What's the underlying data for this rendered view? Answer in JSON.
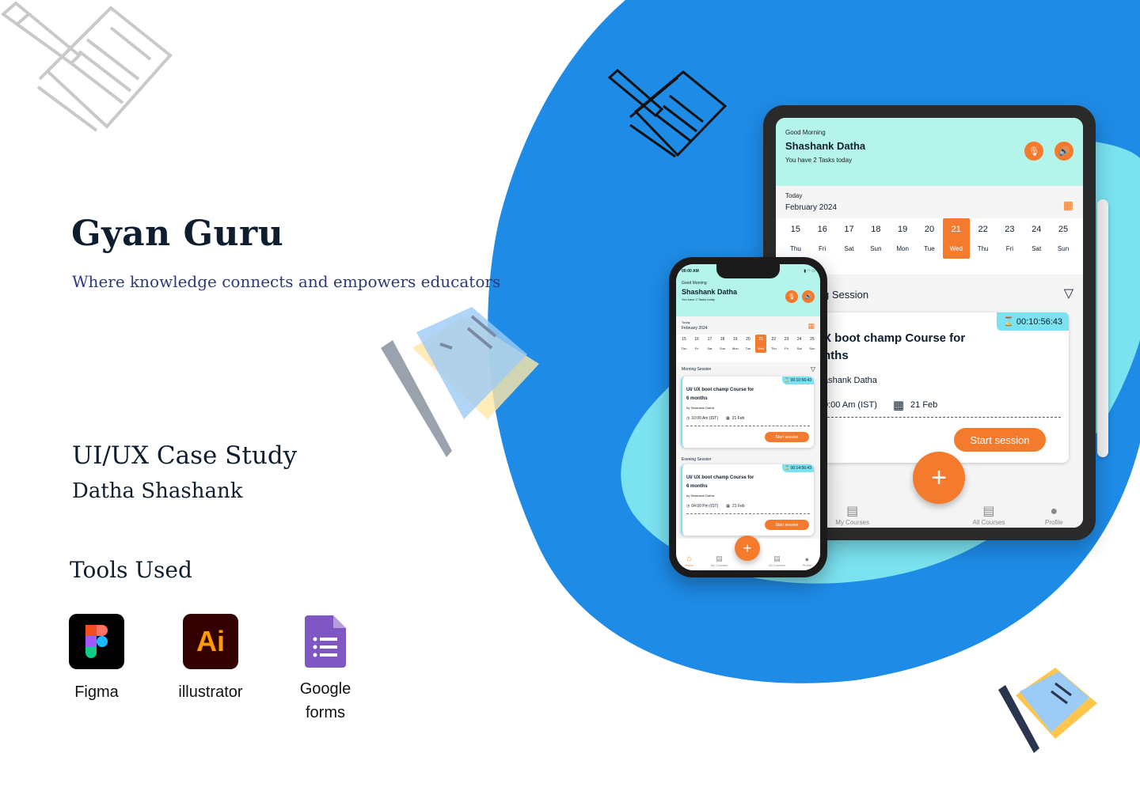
{
  "colors": {
    "blue": "#1e8be6",
    "light_blue": "#7be2f0",
    "orange": "#f47b2d",
    "mint": "#b5f4ea",
    "dark_text": "#0f1e2e",
    "subtitle": "#2d3a7a"
  },
  "hero": {
    "title": "Gyan Guru",
    "subtitle": "Where knowledge connects and empowers educators",
    "case_title": "UI/UX Case Study",
    "author": "Datha Shashank"
  },
  "tools": {
    "title": "Tools Used",
    "items": [
      {
        "name": "Figma",
        "icon": "figma-logo"
      },
      {
        "name": "illustrator",
        "icon": "ai-logo",
        "logo_text": "Ai"
      },
      {
        "name": "Google\nforms",
        "icon": "google-forms-logo"
      }
    ]
  },
  "ipad": {
    "greeting": "Good Morning",
    "name": "Shashank Datha",
    "tasks": "You have 2 Tasks today",
    "today": "Today",
    "month": "February 2024",
    "days": [
      {
        "n": "15",
        "w": "Thu"
      },
      {
        "n": "16",
        "w": "Fri"
      },
      {
        "n": "17",
        "w": "Sat"
      },
      {
        "n": "18",
        "w": "Sun"
      },
      {
        "n": "19",
        "w": "Mon"
      },
      {
        "n": "20",
        "w": "Tue"
      },
      {
        "n": "21",
        "w": "Wed",
        "selected": true
      },
      {
        "n": "22",
        "w": "Thu"
      },
      {
        "n": "23",
        "w": "Fri"
      },
      {
        "n": "24",
        "w": "Sat"
      },
      {
        "n": "25",
        "w": "Sun"
      }
    ],
    "session": "g Session",
    "card": {
      "timer": "00:10:56:43",
      "title_l1": "X boot champ Course for",
      "title_l2": "nths",
      "by": "ashank Datha",
      "time": "0:00 Am (IST)",
      "date": "21 Feb",
      "button": "Start session"
    },
    "nav": [
      "My Courses",
      "All Courses",
      "Profile"
    ]
  },
  "phone": {
    "status_time": "00:00 AM",
    "greeting": "Good Morning",
    "name": "Shashank Datha",
    "tasks": "You have 2 Tasks today",
    "today": "Today",
    "month": "February 2024",
    "days": [
      {
        "n": "15",
        "w": "Thu"
      },
      {
        "n": "16",
        "w": "Fri"
      },
      {
        "n": "17",
        "w": "Sat"
      },
      {
        "n": "18",
        "w": "Sun"
      },
      {
        "n": "19",
        "w": "Mon"
      },
      {
        "n": "20",
        "w": "Tue"
      },
      {
        "n": "21",
        "w": "Wed",
        "selected": true
      },
      {
        "n": "22",
        "w": "Thu"
      },
      {
        "n": "23",
        "w": "Fri"
      },
      {
        "n": "24",
        "w": "Sat"
      },
      {
        "n": "25",
        "w": "Sun"
      }
    ],
    "morning": {
      "label": "Morning Session",
      "timer": "00:10:56:43",
      "title_l1": "UI/ UX boot champ Course for",
      "title_l2": "6 months",
      "by": "by Shashank Datha",
      "time": "10:00 Am (IST)",
      "date": "21 Feb",
      "button": "Start session"
    },
    "evening": {
      "label": "Evening Session",
      "timer": "00:14:56:43",
      "title_l1": "UI/ UX boot champ Course for",
      "title_l2": "6 months",
      "by": "by Shashank Datha",
      "time": "04:00 Pm (IST)",
      "date": "21 Feb",
      "button": "Start session"
    },
    "nav": [
      "Home",
      "My Courses",
      "All Courses",
      "Profile"
    ]
  }
}
